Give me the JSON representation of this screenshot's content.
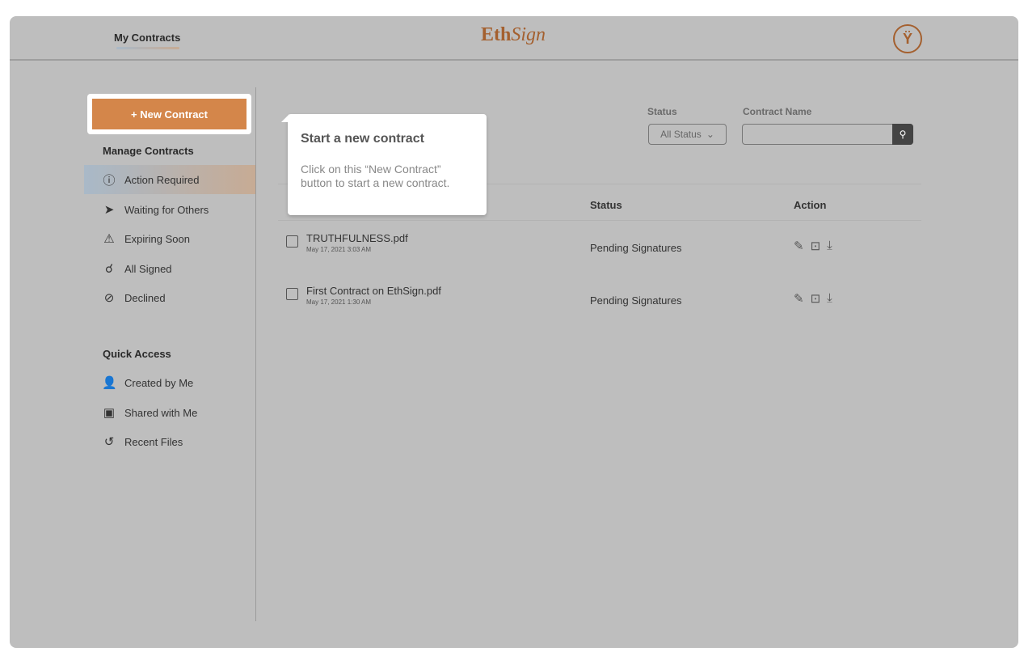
{
  "header": {
    "nav_label": "My Contracts",
    "logo": "EthSign",
    "logo_a": "Eth",
    "logo_b": "Sign",
    "avatar_icon": "user-avatar-icon"
  },
  "sidebar": {
    "new_contract": "+ New Contract",
    "manage_title": "Manage Contracts",
    "manage_items": [
      {
        "label": "Action Required",
        "icon": "alert-circle-icon",
        "active": true
      },
      {
        "label": "Waiting for Others",
        "icon": "send-icon"
      },
      {
        "label": "Expiring Soon",
        "icon": "warning-icon"
      },
      {
        "label": "All Signed",
        "icon": "bulb-icon"
      },
      {
        "label": "Declined",
        "icon": "ban-icon"
      }
    ],
    "quick_title": "Quick Access",
    "quick_items": [
      {
        "label": "Created by Me",
        "icon": "user-add-icon"
      },
      {
        "label": "Shared with Me",
        "icon": "inbox-icon"
      },
      {
        "label": "Recent Files",
        "icon": "history-icon"
      }
    ]
  },
  "filters": {
    "status_label": "Status",
    "status_value": "All Status",
    "name_label": "Contract Name",
    "name_value": ""
  },
  "table": {
    "headers": {
      "status": "Status",
      "action": "Action"
    },
    "rows": [
      {
        "name": "TRUTHFULNESS.pdf",
        "date": "May 17, 2021 3:03 AM",
        "status": "Pending Signatures"
      },
      {
        "name": "First Contract on EthSign.pdf",
        "date": "May 17, 2021 1:30 AM",
        "status": "Pending Signatures"
      }
    ]
  },
  "tooltip": {
    "title": "Start a new contract",
    "body": "Click on this “New Contract” button to start a new contract."
  },
  "colors": {
    "accent": "#d4864a",
    "brand": "#a4602f",
    "overlay": "#bebebe"
  }
}
